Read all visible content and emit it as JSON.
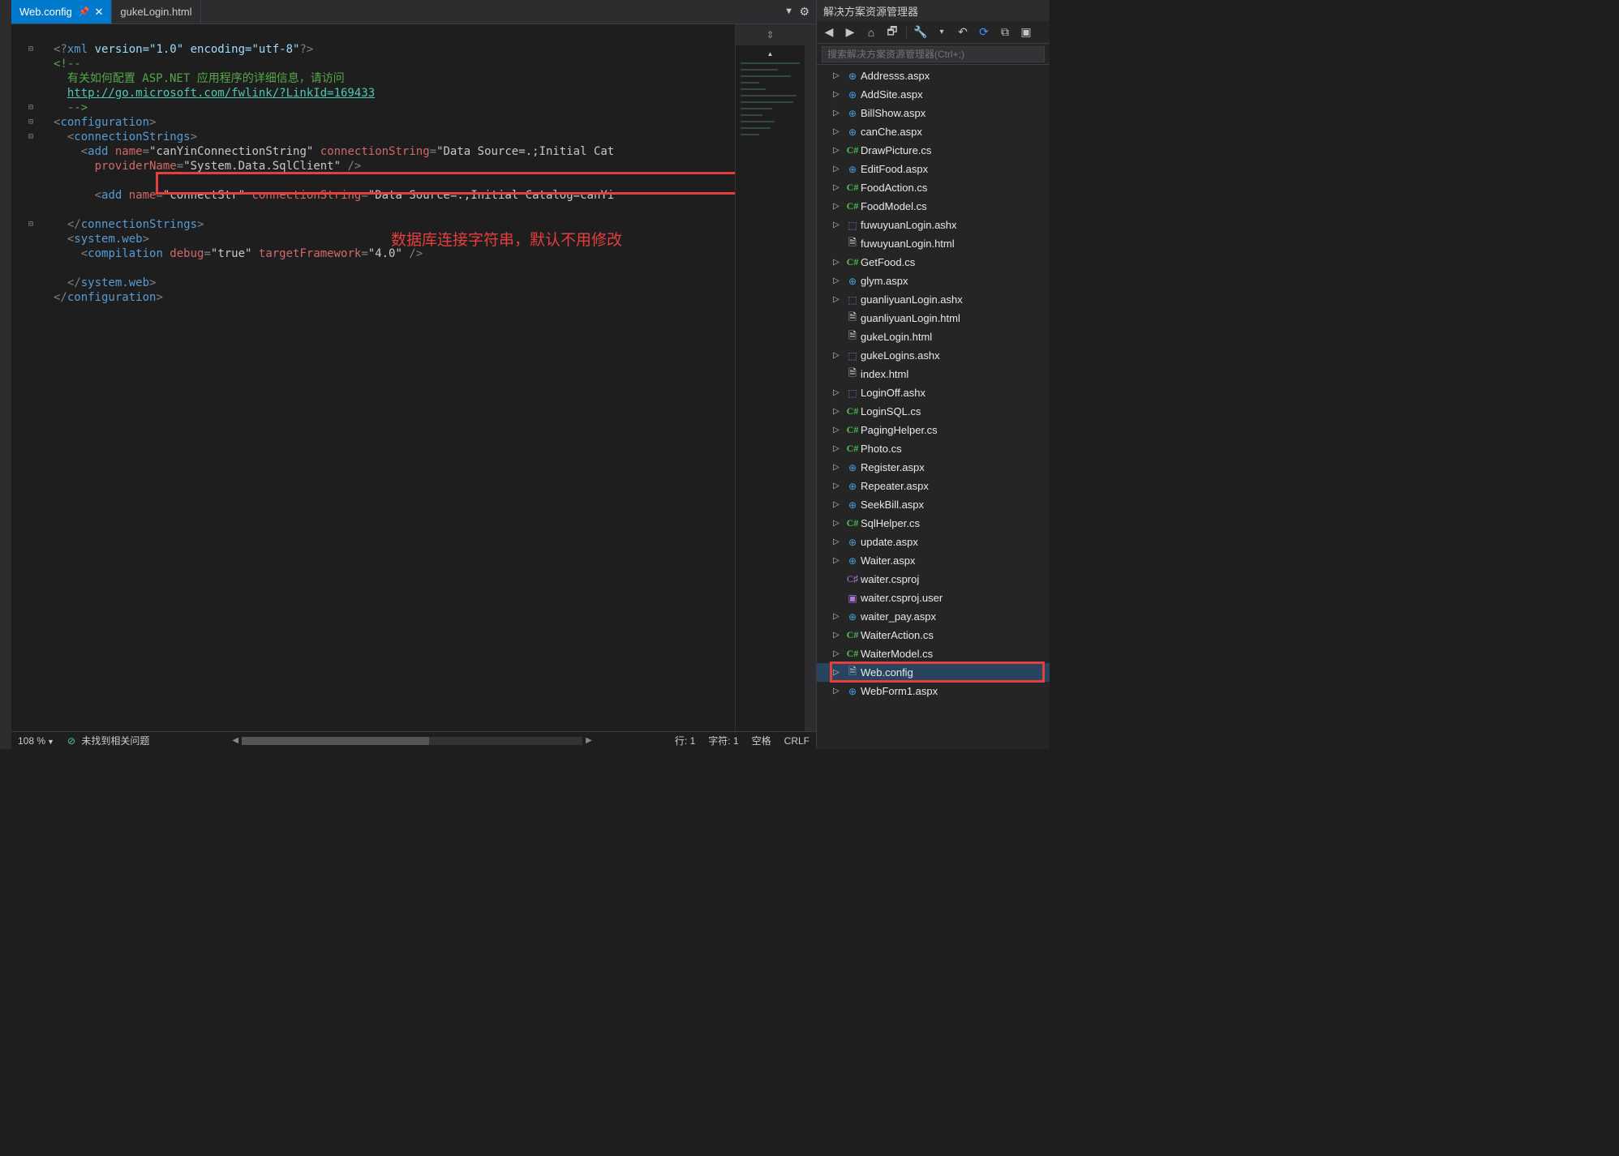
{
  "tabs": {
    "active": {
      "label": "Web.config",
      "pin_glyph": "📌",
      "close_glyph": "✕"
    },
    "inactive": {
      "label": "gukeLogin.html"
    },
    "dropdown_glyph": "▼",
    "gear_glyph": "⚙"
  },
  "editor": {
    "splitter_glyph": "⇕",
    "code": {
      "l1": {
        "punc1": "<?",
        "tag": "xml",
        "attrs": " version=\"1.0\" encoding=\"utf-8\"",
        "punc2": "?>"
      },
      "l2": {
        "punc": "<!--"
      },
      "l3": {
        "text": "  有关如何配置 ASP.NET 应用程序的详细信息，请访问"
      },
      "l4": {
        "link": "http://go.microsoft.com/fwlink/?LinkId=169433"
      },
      "l5": {
        "punc": "  -->"
      },
      "l6": {
        "open": "<",
        "tag": "configuration",
        "close": ">"
      },
      "l7": {
        "indent": "  ",
        "open": "<",
        "tag": "connectionStrings",
        "close": ">"
      },
      "l8": {
        "indent": "    ",
        "open": "<",
        "tag": "add",
        "a1": " name",
        "eq1": "=",
        "v1": "\"canYinConnectionString\"",
        "a2": " connectionString",
        "eq2": "=",
        "v2": "\"Data Source=.;Initial Cat"
      },
      "l9": {
        "indent": "      ",
        "a1": "providerName",
        "eq1": "=",
        "v1": "\"System.Data.SqlClient\"",
        "close": " />"
      },
      "l10": {
        "text": ""
      },
      "l11": {
        "indent": "      ",
        "open": "<",
        "tag": "add",
        "a1": " name",
        "eq1": "=",
        "v1": "\"connectStr\"",
        "a2": " connectionString",
        "eq2": "=",
        "v2": "\"Data Source=.;Initial Catalog=canYi"
      },
      "l12": {
        "text": ""
      },
      "l13": {
        "indent": "  ",
        "open": "</",
        "tag": "connectionStrings",
        "close": ">"
      },
      "l14": {
        "indent": "  ",
        "open": "<",
        "tag": "system.web",
        "close": ">"
      },
      "l15": {
        "indent": "    ",
        "open": "<",
        "tag": "compilation",
        "a1": " debug",
        "eq1": "=",
        "v1": "\"true\"",
        "a2": " targetFramework",
        "eq2": "=",
        "v2": "\"4.0\"",
        "close": " />"
      },
      "l16": {
        "text": ""
      },
      "l17": {
        "indent": "  ",
        "open": "</",
        "tag": "system.web",
        "close": ">"
      },
      "l18": {
        "open": "</",
        "tag": "configuration",
        "close": ">"
      }
    },
    "annotation_text": "数据库连接字符串，默认不用修改"
  },
  "statusbar": {
    "zoom": "108 %",
    "issues_glyph": "⊘",
    "issues": " 未找到相关问题",
    "ln_label": "行:",
    "ln_value": "1",
    "ch_label": "字符:",
    "ch_value": "1",
    "spaces": "空格",
    "crlf": "CRLF"
  },
  "solution_explorer": {
    "title": "解决方案资源管理器",
    "search_placeholder": "搜索解决方案资源管理器(Ctrl+;)",
    "toolbar": {
      "back": "◀",
      "fwd": "▶",
      "home": "⌂",
      "sync2": "🗗",
      "wrench": "🔧",
      "pipe": "|",
      "undo": "↶",
      "refresh": "⟳",
      "collapse": "⧉",
      "props": "▣"
    },
    "items": [
      {
        "label": "Addresss.aspx",
        "kind": "aspx",
        "expandable": true
      },
      {
        "label": "AddSite.aspx",
        "kind": "aspx",
        "expandable": true
      },
      {
        "label": "BillShow.aspx",
        "kind": "aspx",
        "expandable": true
      },
      {
        "label": "canChe.aspx",
        "kind": "aspx",
        "expandable": true
      },
      {
        "label": "DrawPicture.cs",
        "kind": "cs",
        "expandable": true
      },
      {
        "label": "EditFood.aspx",
        "kind": "aspx",
        "expandable": true
      },
      {
        "label": "FoodAction.cs",
        "kind": "cs",
        "expandable": true
      },
      {
        "label": "FoodModel.cs",
        "kind": "cs",
        "expandable": true
      },
      {
        "label": "fuwuyuanLogin.ashx",
        "kind": "ashx",
        "expandable": true
      },
      {
        "label": "fuwuyuanLogin.html",
        "kind": "html",
        "expandable": false
      },
      {
        "label": "GetFood.cs",
        "kind": "cs",
        "expandable": true
      },
      {
        "label": "glym.aspx",
        "kind": "aspx",
        "expandable": true
      },
      {
        "label": "guanliyuanLogin.ashx",
        "kind": "ashx",
        "expandable": true
      },
      {
        "label": "guanliyuanLogin.html",
        "kind": "html",
        "expandable": false
      },
      {
        "label": "gukeLogin.html",
        "kind": "html",
        "expandable": false
      },
      {
        "label": "gukeLogins.ashx",
        "kind": "ashx",
        "expandable": true
      },
      {
        "label": "index.html",
        "kind": "html",
        "expandable": false
      },
      {
        "label": "LoginOff.ashx",
        "kind": "ashx",
        "expandable": true
      },
      {
        "label": "LoginSQL.cs",
        "kind": "cs",
        "expandable": true
      },
      {
        "label": "PagingHelper.cs",
        "kind": "cs",
        "expandable": true
      },
      {
        "label": "Photo.cs",
        "kind": "cs",
        "expandable": true
      },
      {
        "label": "Register.aspx",
        "kind": "aspx",
        "expandable": true
      },
      {
        "label": "Repeater.aspx",
        "kind": "aspx",
        "expandable": true
      },
      {
        "label": "SeekBill.aspx",
        "kind": "aspx",
        "expandable": true
      },
      {
        "label": "SqlHelper.cs",
        "kind": "cs",
        "expandable": true
      },
      {
        "label": "update.aspx",
        "kind": "aspx",
        "expandable": true
      },
      {
        "label": "Waiter.aspx",
        "kind": "aspx",
        "expandable": true
      },
      {
        "label": "waiter.csproj",
        "kind": "csproj",
        "expandable": false
      },
      {
        "label": "waiter.csproj.user",
        "kind": "csprojuser",
        "expandable": false
      },
      {
        "label": "waiter_pay.aspx",
        "kind": "aspx",
        "expandable": true
      },
      {
        "label": "WaiterAction.cs",
        "kind": "cs",
        "expandable": true
      },
      {
        "label": "WaiterModel.cs",
        "kind": "cs",
        "expandable": true
      },
      {
        "label": "Web.config",
        "kind": "config",
        "expandable": true,
        "selected": true
      },
      {
        "label": "WebForm1.aspx",
        "kind": "aspx",
        "expandable": true
      }
    ],
    "icon_text": {
      "cs": "C#",
      "aspx": "⊕",
      "ashx": "⬚",
      "html": "🗎",
      "config": "🗎",
      "csproj": "C♯",
      "csprojuser": "▣"
    }
  }
}
